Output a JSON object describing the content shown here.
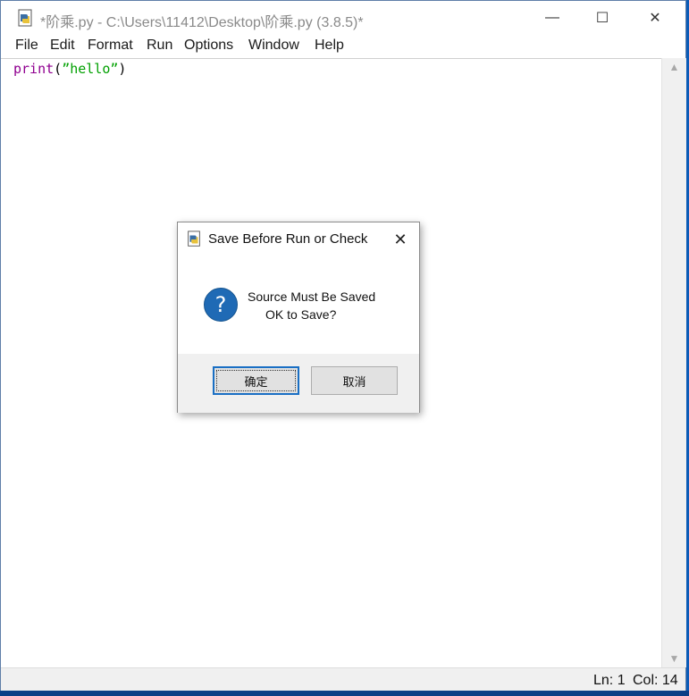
{
  "window": {
    "title": "*阶乘.py - C:\\Users\\11412\\Desktop\\阶乘.py (3.8.5)*",
    "controls": {
      "minimize": "—",
      "maximize": "☐",
      "close": "✕"
    }
  },
  "menu": {
    "items": [
      "File",
      "Edit",
      "Format",
      "Run",
      "Options",
      "Window",
      "Help"
    ]
  },
  "editor": {
    "code": {
      "keyword": "print",
      "open": "(",
      "string": "”hello”",
      "close": ")"
    }
  },
  "statusbar": {
    "ln": "Ln: 1",
    "col": "Col: 14"
  },
  "dialog": {
    "title": "Save Before Run or Check",
    "message_line1": "Source Must Be Saved",
    "message_line2": "OK to Save?",
    "ok_label": "确定",
    "cancel_label": "取消",
    "close_glyph": "✕",
    "question_glyph": "?"
  },
  "colors": {
    "keyword": "#900090",
    "string": "#00a000",
    "question_icon": "#1f6ab5",
    "default_button_border": "#1a6fc4"
  }
}
